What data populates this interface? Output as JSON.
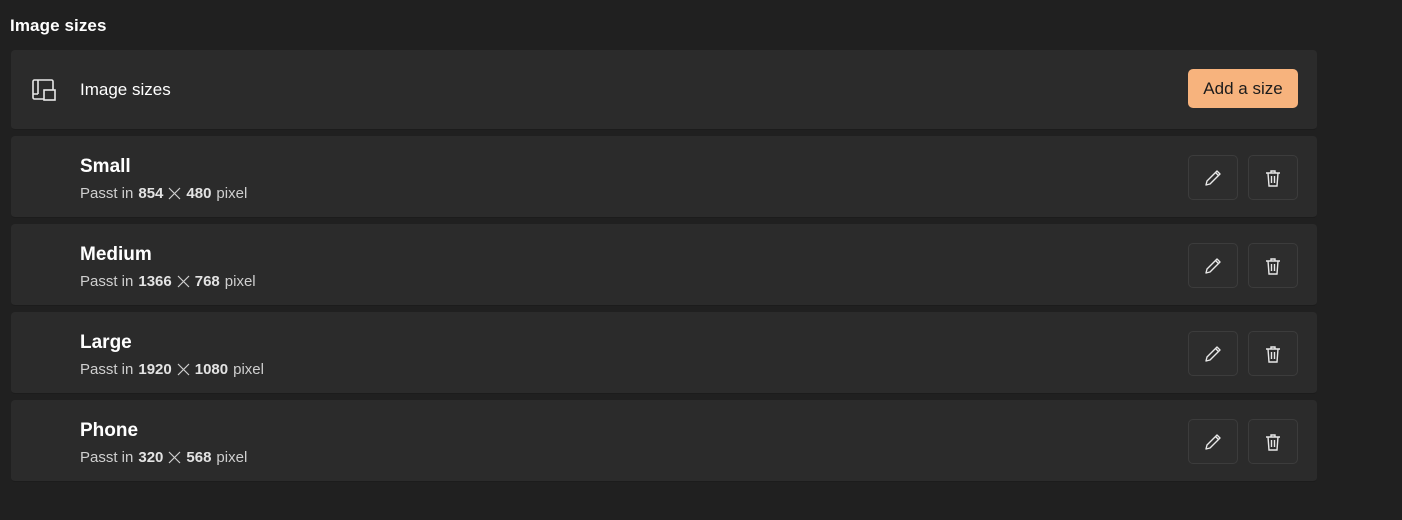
{
  "section": {
    "title": "Image sizes"
  },
  "header": {
    "icon": "image-resize-icon",
    "label": "Image sizes",
    "add_button_label": "Add a size"
  },
  "sizes": [
    {
      "name": "Small",
      "prefix": "Passt in",
      "width": "854",
      "height": "480",
      "unit": "pixel"
    },
    {
      "name": "Medium",
      "prefix": "Passt in",
      "width": "1366",
      "height": "768",
      "unit": "pixel"
    },
    {
      "name": "Large",
      "prefix": "Passt in",
      "width": "1920",
      "height": "1080",
      "unit": "pixel"
    },
    {
      "name": "Phone",
      "prefix": "Passt in",
      "width": "320",
      "height": "568",
      "unit": "pixel"
    }
  ],
  "icons": {
    "edit": "pencil-icon",
    "delete": "trash-icon",
    "times": "times-icon"
  },
  "colors": {
    "background": "#202020",
    "card": "#2b2b2b",
    "accent": "#f7b37d"
  }
}
